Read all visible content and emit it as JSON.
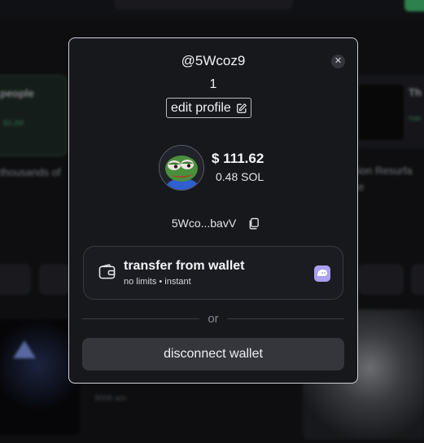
{
  "background": {
    "left_card_title": "people",
    "left_card_sub": "$3.2M",
    "left_text": "thousands of",
    "right_card_title": "Th",
    "right_card_sub": "mar",
    "right_text1": "ion Resurfa",
    "right_text2": "e",
    "bottom_text": "9006 am"
  },
  "modal": {
    "username": "@5Wcoz9",
    "count": "1",
    "edit_profile_label": "edit profile",
    "balance_usd": "$ 111.62",
    "balance_sol": "0.48 SOL",
    "address": "5Wco...bavV",
    "transfer": {
      "title": "transfer from wallet",
      "subtitle": "no limits • instant"
    },
    "divider_text": "or",
    "disconnect_label": "disconnect wallet",
    "close_glyph": "✕"
  },
  "colors": {
    "modal_bg": "#17181c",
    "modal_border": "#cfd0d6",
    "button_bg": "#35363c",
    "phantom_purple": "#ab9ff2",
    "accent_green": "#4ad27a"
  },
  "icons": [
    "close-icon",
    "edit-icon",
    "copy-icon",
    "wallet-icon",
    "phantom-icon",
    "pepe-avatar"
  ]
}
